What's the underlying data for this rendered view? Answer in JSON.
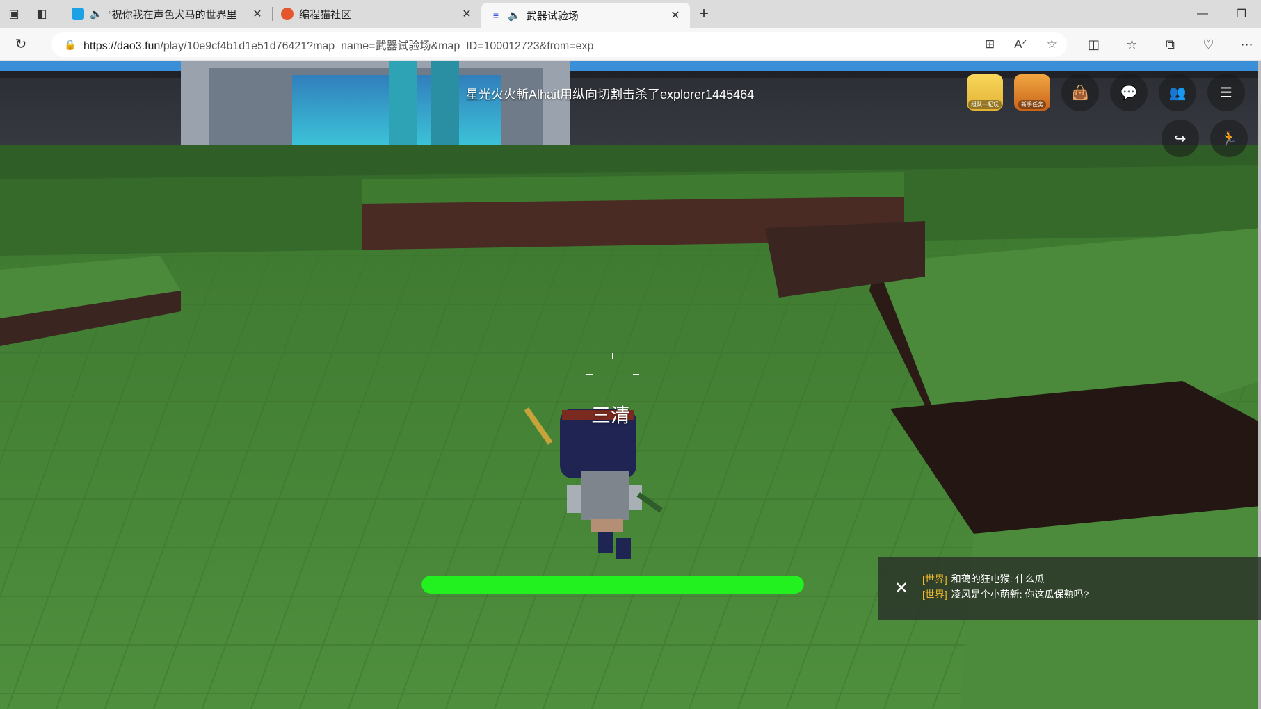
{
  "browser": {
    "tabs": [
      {
        "title": "“祝你我在声色犬马的世界里",
        "favicon": "bilibili-icon",
        "audio": true
      },
      {
        "title": "编程猫社区",
        "favicon": "codemao-icon",
        "audio": false
      },
      {
        "title": "武器试验场",
        "favicon": "dao3-icon",
        "audio": true,
        "active": true
      }
    ],
    "url": {
      "host": "https://dao3.fun",
      "path": "/play/10e9cf4b1d1e51d76421?map_name=武器试验场&map_ID=100012723&from=exp"
    }
  },
  "game": {
    "kill_feed": "星光火火斬Alhait用纵向切割击杀了explorer1445464",
    "player_name": "三清",
    "health_fraction": 1.0,
    "hud_badges": [
      {
        "label": "组队一起玩"
      },
      {
        "label": "新手任务"
      }
    ],
    "chat": [
      {
        "channel": "[世界]",
        "text": "和蔼的狂电猴: 什么瓜"
      },
      {
        "channel": "[世界]",
        "text": "凌风是个小萌新: 你这瓜保熟吗?"
      }
    ]
  },
  "colors": {
    "health": "#22f01f",
    "chat_channel": "#f0b82a",
    "grass": "#4d8a3c"
  }
}
